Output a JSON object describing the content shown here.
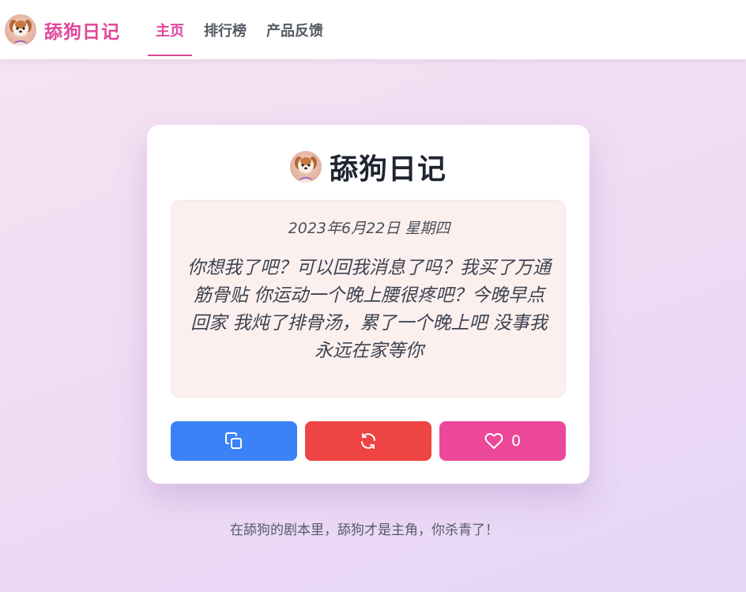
{
  "navbar": {
    "brand_icon": "dog-avatar-icon",
    "brand_name": "舔狗日记",
    "tabs": [
      {
        "label": "主页",
        "active": true
      },
      {
        "label": "排行榜",
        "active": false
      },
      {
        "label": "产品反馈",
        "active": false
      }
    ]
  },
  "card": {
    "title_icon": "dog-avatar-icon",
    "title": "舔狗日记",
    "diary": {
      "date": "2023年6月22日 星期四",
      "text": "你想我了吧？可以回我消息了吗？我买了万通筋骨贴 你运动一个晚上腰很疼吧？今晚早点回家 我炖了排骨汤，累了一个晚上吧 没事我永远在家等你"
    },
    "buttons": {
      "copy_icon": "copy-icon",
      "refresh_icon": "refresh-icon",
      "like_icon": "heart-icon",
      "like_count": "0"
    }
  },
  "footer": {
    "text": "在舔狗的剧本里，舔狗才是主角，你杀青了！"
  },
  "colors": {
    "brand_pink": "#e0479a",
    "copy_blue": "#3b82f6",
    "refresh_red": "#ef4444",
    "like_pink": "#ec4899",
    "diary_bg": "#fcf0ef"
  }
}
